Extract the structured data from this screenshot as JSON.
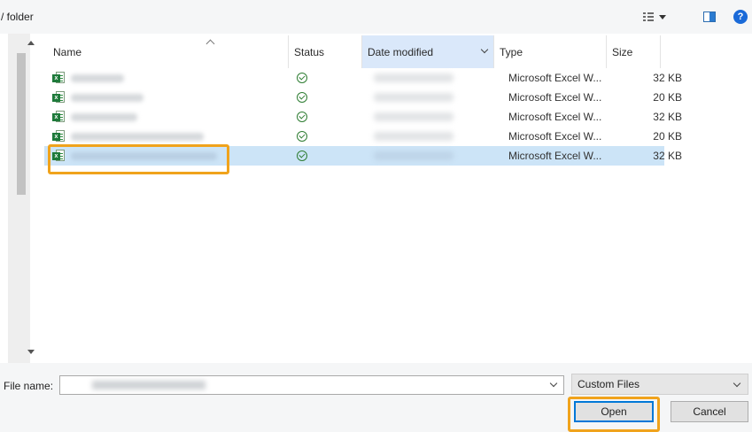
{
  "toolbar": {
    "title": " / folder",
    "help_label": "?"
  },
  "columns": {
    "name": "Name",
    "status": "Status",
    "date_modified": "Date modified",
    "type": "Type",
    "size": "Size"
  },
  "files": [
    {
      "type": "Microsoft Excel W...",
      "size": "32 KB"
    },
    {
      "type": "Microsoft Excel W...",
      "size": "20 KB"
    },
    {
      "type": "Microsoft Excel W...",
      "size": "32 KB"
    },
    {
      "type": "Microsoft Excel W...",
      "size": "20 KB"
    },
    {
      "type": "Microsoft Excel W...",
      "size": "32 KB"
    }
  ],
  "bottom": {
    "file_name_label": "File name:",
    "filter_value": "Custom Files",
    "open_label": "Open",
    "cancel_label": "Cancel"
  },
  "icons": {
    "file": "excel-file-icon",
    "status": "synced-check-icon",
    "view": "view-options-icon",
    "pane": "preview-pane-icon",
    "help": "help-icon"
  },
  "colors": {
    "accent": "#0078d7",
    "selection": "#cce4f7",
    "highlight": "#f0a31c",
    "excel_green": "#1e7a3a"
  }
}
